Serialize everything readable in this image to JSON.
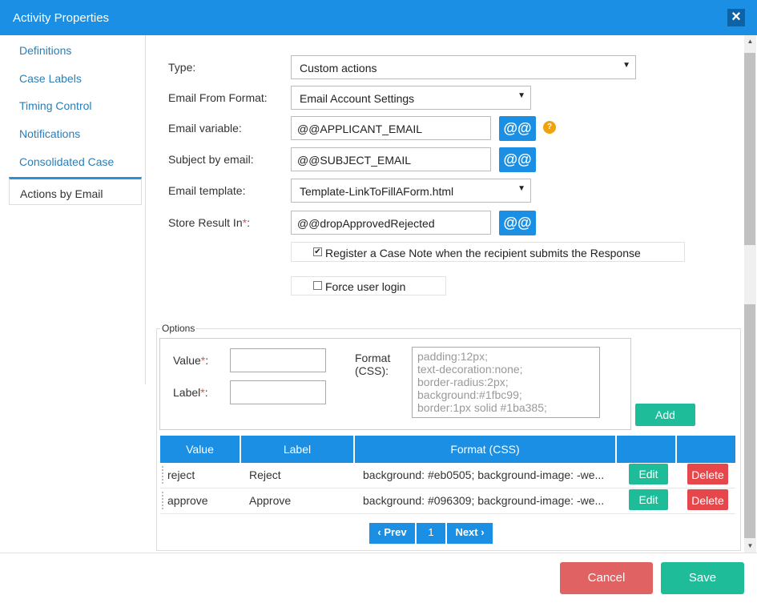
{
  "window": {
    "title": "Activity Properties"
  },
  "sidebar": {
    "items": [
      {
        "label": "Definitions"
      },
      {
        "label": "Case Labels"
      },
      {
        "label": "Timing Control"
      },
      {
        "label": "Notifications"
      },
      {
        "label": "Consolidated Case"
      },
      {
        "label": "Actions by Email"
      }
    ],
    "active_index": 5
  },
  "form": {
    "type": {
      "label": "Type:",
      "value": "Custom actions"
    },
    "email_from_format": {
      "label": "Email From Format:",
      "value": "Email Account Settings"
    },
    "email_variable": {
      "label": "Email variable:",
      "value": "@@APPLICANT_EMAIL",
      "button": "@@",
      "help": "?"
    },
    "subject": {
      "label": "Subject by email:",
      "value": "@@SUBJECT_EMAIL",
      "button": "@@"
    },
    "template": {
      "label": "Email template:",
      "value": "Template-LinkToFillAForm.html"
    },
    "store_result": {
      "label": "Store Result In",
      "required": "*",
      "colon": ":",
      "value": "@@dropApprovedRejected",
      "button": "@@"
    },
    "register_note": {
      "label": "Register a Case Note when the recipient submits the Response",
      "checked": true,
      "check_glyph": "✔"
    },
    "force_login": {
      "label": "Force user login",
      "checked": false
    }
  },
  "options": {
    "legend": "Options",
    "value_label": "Value",
    "label_label": "Label",
    "required": "*",
    "colon": ":",
    "format_label_1": "Format",
    "format_label_2": "(CSS):",
    "format_placeholder": "padding:12px;\ntext-decoration:none;\nborder-radius:2px;\nbackground:#1fbc99;\nborder:1px solid #1ba385;",
    "add_button": "Add",
    "table": {
      "headers": [
        "Value",
        "Label",
        "Format (CSS)",
        "",
        ""
      ],
      "rows": [
        {
          "value": "reject",
          "label": "Reject",
          "format": "background: #eb0505; background-image: -we...",
          "edit": "Edit",
          "delete": "Delete"
        },
        {
          "value": "approve",
          "label": "Approve",
          "format": "background: #096309; background-image: -we...",
          "edit": "Edit",
          "delete": "Delete"
        }
      ]
    },
    "pagination": {
      "prev": "‹ Prev",
      "page": "1",
      "next": "Next ›"
    }
  },
  "footer": {
    "cancel": "Cancel",
    "save": "Save"
  },
  "colors": {
    "accent": "#1a8fe3",
    "success": "#1fbc99",
    "danger": "#e06262",
    "help": "#f0a30a"
  }
}
